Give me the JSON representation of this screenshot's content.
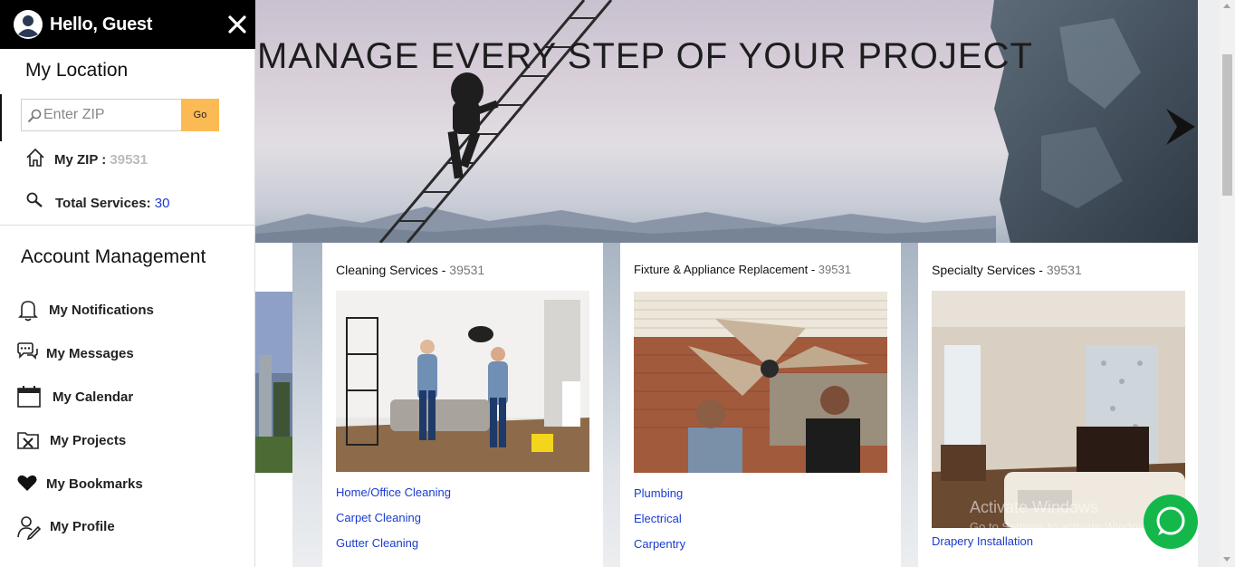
{
  "hero": {
    "title": "MANAGE EVERY STEP OF YOUR PROJECT"
  },
  "cards": [
    {
      "title": "Cleaning Services - ",
      "zip": "39531",
      "links": [
        "Home/Office Cleaning",
        "Carpet Cleaning",
        "Gutter Cleaning"
      ]
    },
    {
      "title": "Fixture & Appliance Replacement - ",
      "zip": "39531",
      "links": [
        "Plumbing",
        "Electrical",
        "Carpentry"
      ]
    },
    {
      "title": "Specialty Services - ",
      "zip": "39531",
      "links": [
        "Drapery Installation"
      ]
    }
  ],
  "watermark": {
    "title": "Activate Windows",
    "subtitle": "Go to Settings to activate Windows."
  },
  "sidebar": {
    "greeting": "Hello, Guest",
    "location_title": "My Location",
    "zip_placeholder": "Enter ZIP",
    "go_label": "Go",
    "my_zip_label": "My ZIP : ",
    "my_zip_value": "39531",
    "total_services_label": "Total Services: ",
    "total_services_value": "30",
    "account_title": "Account Management",
    "items": [
      {
        "label": "My Notifications",
        "icon": "bell-icon"
      },
      {
        "label": "My Messages",
        "icon": "chat-bubbles-icon"
      },
      {
        "label": "My Calendar",
        "icon": "calendar-icon"
      },
      {
        "label": "My Projects",
        "icon": "projects-icon"
      },
      {
        "label": "My Bookmarks",
        "icon": "heart-icon"
      },
      {
        "label": "My Profile",
        "icon": "profile-edit-icon"
      }
    ]
  },
  "colors": {
    "header_bg": "#000000",
    "go_button": "#fcba55",
    "link_blue": "#1a3bd0",
    "chat_green": "#14b84a"
  }
}
